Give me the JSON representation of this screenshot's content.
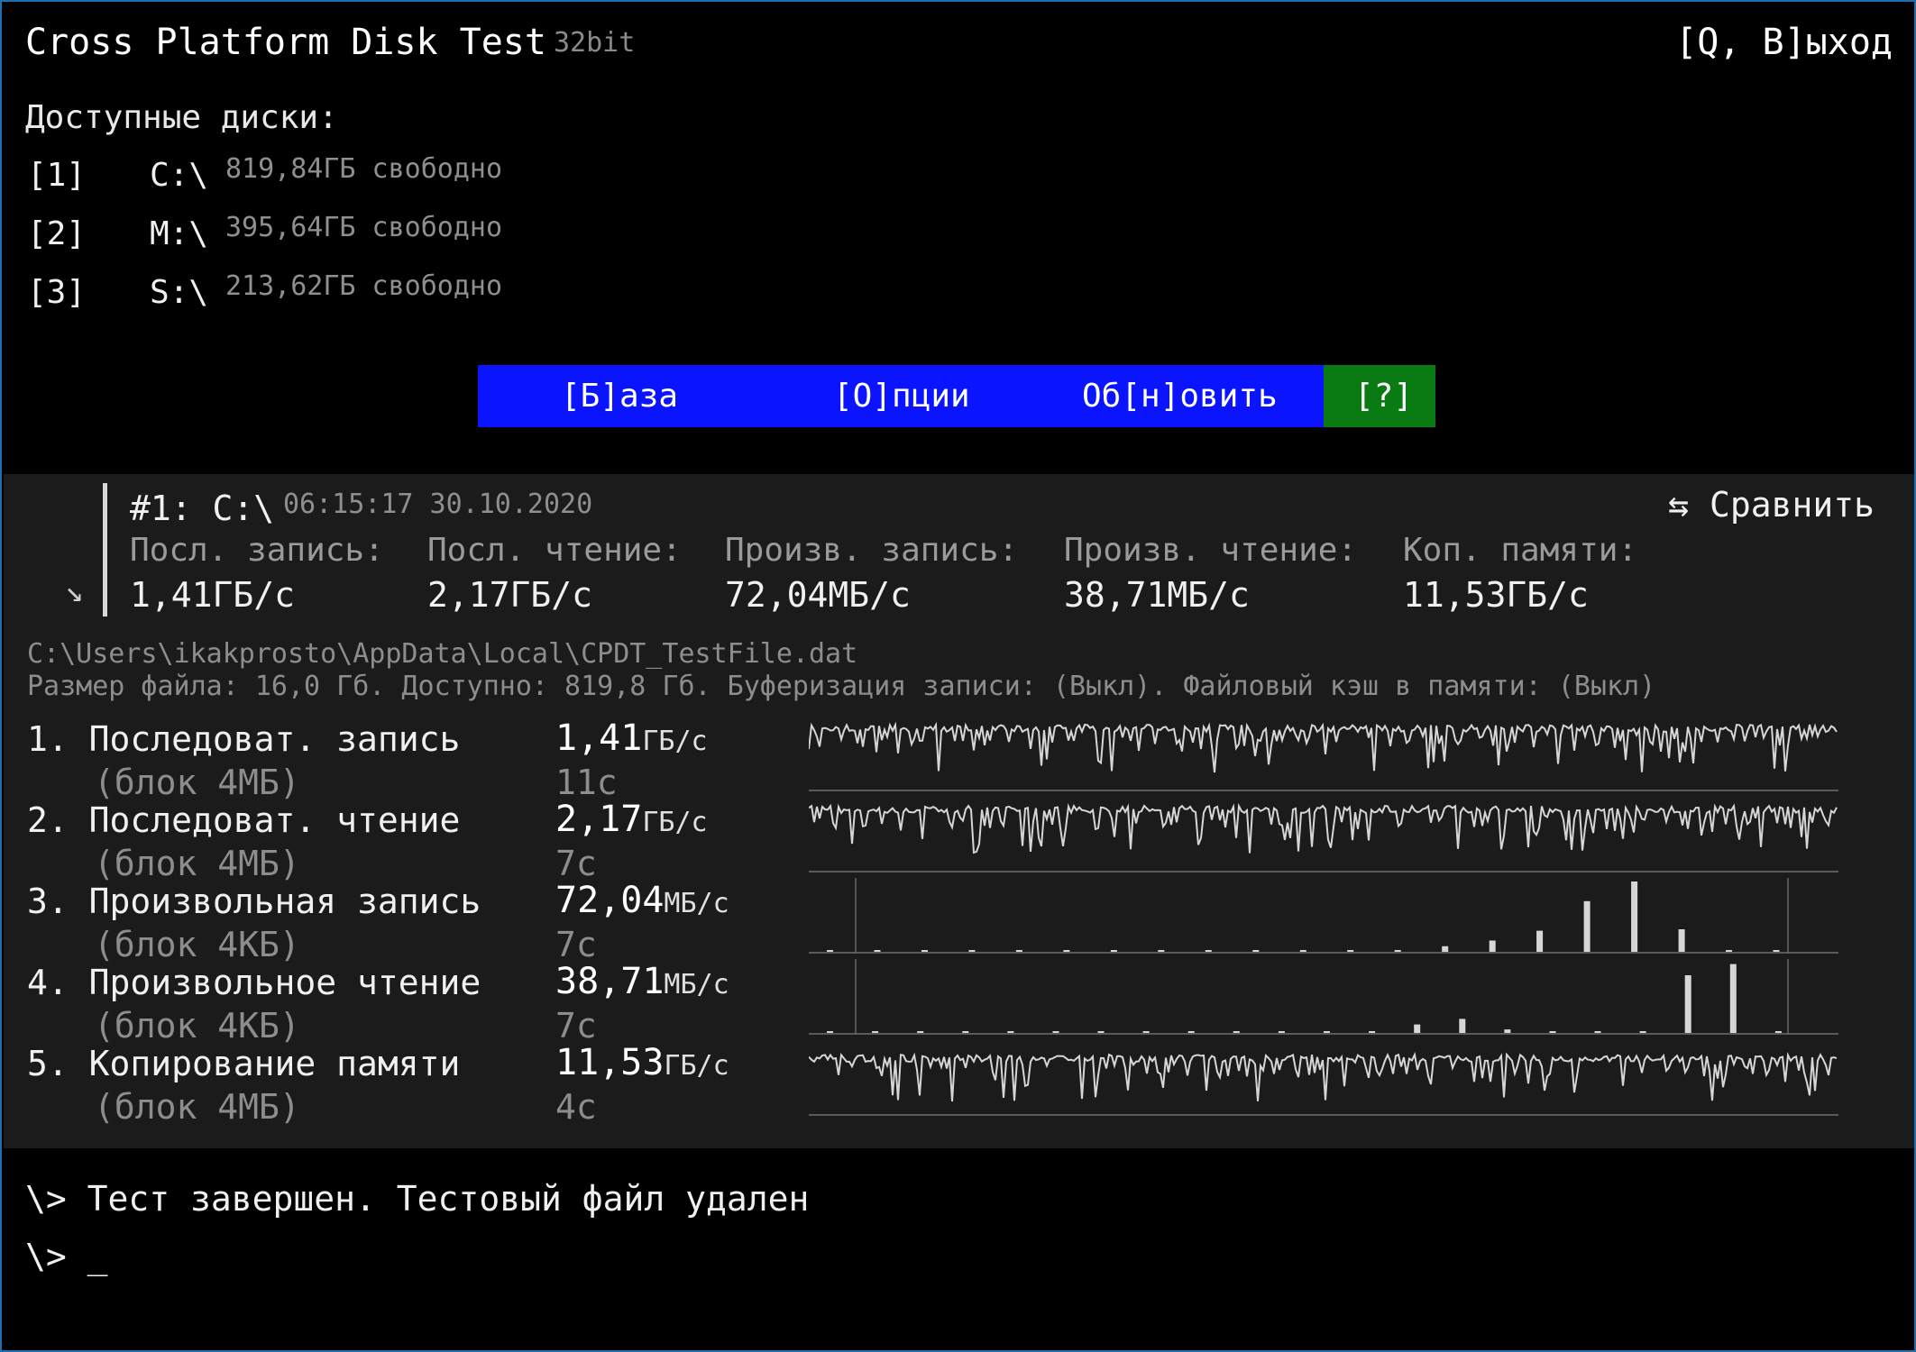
{
  "app": {
    "title": "Cross Platform Disk Test",
    "bitness": "32bit",
    "exit_label": "[Q, В]ыход"
  },
  "disks": {
    "heading": "Доступные диски:",
    "items": [
      {
        "key": "[1]",
        "letter": "C:\\",
        "free": "819,84ГБ свободно"
      },
      {
        "key": "[2]",
        "letter": "M:\\",
        "free": "395,64ГБ свободно"
      },
      {
        "key": "[3]",
        "letter": "S:\\",
        "free": "213,62ГБ свободно"
      }
    ]
  },
  "menu": {
    "base": "[Б]аза",
    "options": "[О]пции",
    "refresh": "Об[н]овить",
    "help": "[?]",
    "colors": {
      "bar": "#0a14ff",
      "help": "#0a7a12"
    }
  },
  "result": {
    "id": "#1: C:\\",
    "datetime": "06:15:17 30.10.2020",
    "compare": "⇆ Сравнить",
    "corner_arrow": "↘",
    "summary": [
      {
        "label": "Посл. запись:",
        "value": "1,41ГБ/с"
      },
      {
        "label": "Посл. чтение:",
        "value": "2,17ГБ/с"
      },
      {
        "label": "Произв. запись:",
        "value": "72,04МБ/с"
      },
      {
        "label": "Произв. чтение:",
        "value": "38,71МБ/с"
      },
      {
        "label": "Коп. памяти:",
        "value": "11,53ГБ/с"
      }
    ],
    "file_path": "C:\\Users\\ikakprosto\\AppData\\Local\\CPDT_TestFile.dat",
    "file_info": "Размер файла: 16,0 Гб. Доступно: 819,8 Гб. Буферизация записи: (Выкл). Файловый кэш в памяти: (Выкл)",
    "tests": [
      {
        "name": "1. Последоват. запись",
        "block": "(блок 4МБ)",
        "speed": "1,41",
        "unit": "ГБ/с",
        "time": "11с",
        "graph": "line"
      },
      {
        "name": "2. Последоват. чтение",
        "block": "(блок 4МБ)",
        "speed": "2,17",
        "unit": "ГБ/с",
        "time": "7с",
        "graph": "line"
      },
      {
        "name": "3. Произвольная запись",
        "block": "(блок 4КБ)",
        "speed": "72,04",
        "unit": "МБ/с",
        "time": "7с",
        "graph": "bars",
        "bars": [
          0.02,
          0.02,
          0.02,
          0.02,
          0.02,
          0.02,
          0.02,
          0.02,
          0.02,
          0.02,
          0.02,
          0.02,
          0.02,
          0.08,
          0.16,
          0.3,
          0.72,
          1.0,
          0.32,
          0.02,
          0.02
        ]
      },
      {
        "name": "4. Произвольное чтение",
        "block": "(блок 4КБ)",
        "speed": "38,71",
        "unit": "МБ/с",
        "time": "7с",
        "graph": "bars",
        "bars": [
          0.02,
          0.02,
          0.02,
          0.02,
          0.02,
          0.02,
          0.02,
          0.02,
          0.02,
          0.02,
          0.02,
          0.02,
          0.02,
          0.12,
          0.2,
          0.05,
          0.02,
          0.02,
          0.02,
          0.82,
          0.98,
          0.02
        ]
      },
      {
        "name": "5. Копирование памяти",
        "block": "(блок 4МБ)",
        "speed": "11,53",
        "unit": "ГБ/с",
        "time": "4с",
        "graph": "line"
      }
    ]
  },
  "console": {
    "line1": "\\> Тест завершен. Тестовый файл удален",
    "line2": "\\> _"
  }
}
